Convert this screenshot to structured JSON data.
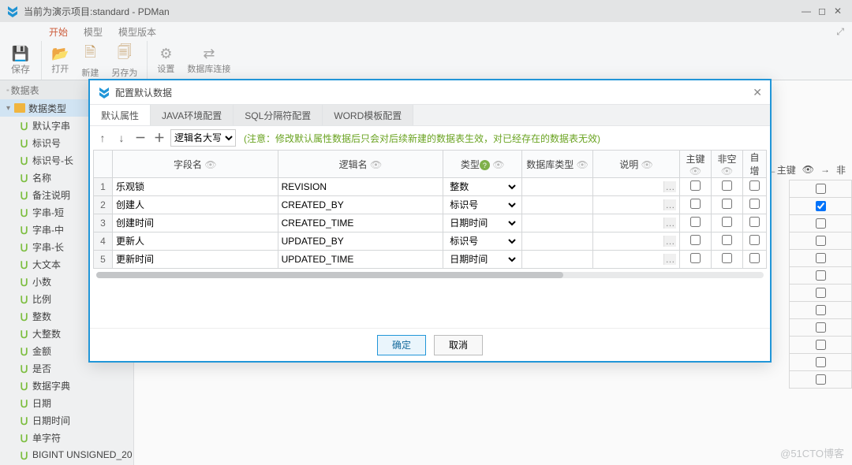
{
  "title": "当前为演示项目:standard - PDMan",
  "menu": {
    "start": "开始",
    "model": "模型",
    "version": "模型版本"
  },
  "ribbon": {
    "save": "保存",
    "open": "打开",
    "new": "新建",
    "saveas": "另存为",
    "settings": "设置",
    "db": "数据库连接"
  },
  "sidebar": {
    "header": "数据表",
    "root": "数据类型",
    "items": [
      "默认字串",
      "标识号",
      "标识号-长",
      "名称",
      "备注说明",
      "字串-短",
      "字串-中",
      "字串-长",
      "大文本",
      "小数",
      "比例",
      "整数",
      "大整数",
      "金额",
      "是否",
      "数据字典",
      "日期",
      "日期时间",
      "单字符",
      "BIGINT UNSIGNED_20"
    ]
  },
  "editorHeader": {
    "arrow": "←主键",
    "eye": "👁"
  },
  "modal": {
    "title": "配置默认数据",
    "tabs": [
      "默认属性",
      "JAVA环境配置",
      "SQL分隔符配置",
      "WORD模板配置"
    ],
    "caseSelect": "逻辑名大写",
    "warn": "(注意：修改默认属性数据后只会对后续新建的数据表生效，对已经存在的数据表无效)",
    "columns": {
      "name": "字段名",
      "logic": "逻辑名",
      "type": "类型",
      "dbtype": "数据库类型",
      "desc": "说明",
      "pk": "主键",
      "notnull": "非空",
      "auto": "自增"
    },
    "rows": [
      {
        "n": "1",
        "name": "乐观锁",
        "logic": "REVISION",
        "type": "整数"
      },
      {
        "n": "2",
        "name": "创建人",
        "logic": "CREATED_BY",
        "type": "标识号"
      },
      {
        "n": "3",
        "name": "创建时间",
        "logic": "CREATED_TIME",
        "type": "日期时间"
      },
      {
        "n": "4",
        "name": "更新人",
        "logic": "UPDATED_BY",
        "type": "标识号"
      },
      {
        "n": "5",
        "name": "更新时间",
        "logic": "UPDATED_TIME",
        "type": "日期时间"
      }
    ],
    "ok": "确定",
    "cancel": "取消"
  },
  "watermark": "@51CTO博客"
}
